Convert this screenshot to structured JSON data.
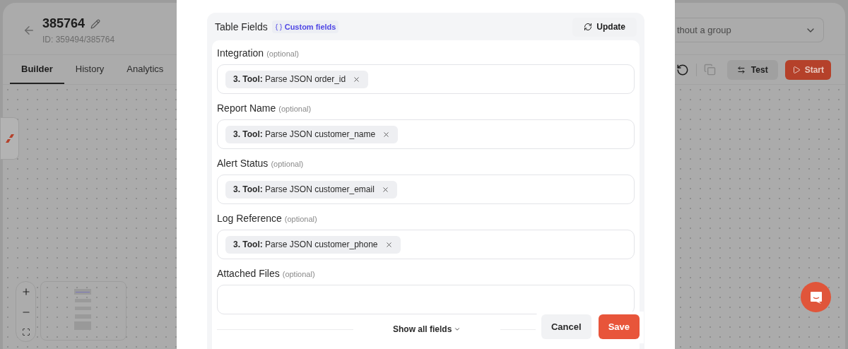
{
  "app": {
    "title": "385764",
    "id_line": "ID: 359494/385764",
    "tabs": [
      {
        "label": "Builder",
        "selected": true
      },
      {
        "label": "History",
        "selected": false
      },
      {
        "label": "Analytics",
        "selected": false
      }
    ],
    "group_select": {
      "value": "thout a group"
    },
    "toolbar": {
      "test": "Test",
      "start": "Start"
    }
  },
  "modal": {
    "section_title": "Table Fields",
    "badge": "Custom fields",
    "update": "Update",
    "fields": [
      {
        "label": "Integration",
        "hint": "(optional)",
        "chips": [
          "**3. Tool:** Parse JSON order_id"
        ]
      },
      {
        "label": "Report Name",
        "hint": "(optional)",
        "chips": [
          "**3. Tool:** Parse JSON customer_name"
        ]
      },
      {
        "label": "Alert Status",
        "hint": "(optional)",
        "chips": [
          "**3. Tool:** Parse JSON customer_email"
        ]
      },
      {
        "label": "Log Reference",
        "hint": "(optional)",
        "chips": [
          "**3. Tool:** Parse JSON customer_phone"
        ]
      },
      {
        "label": "Attached Files",
        "hint": "(optional)"
      }
    ],
    "show_all": "Show all fields",
    "cancel": "Cancel",
    "save": "Save"
  }
}
